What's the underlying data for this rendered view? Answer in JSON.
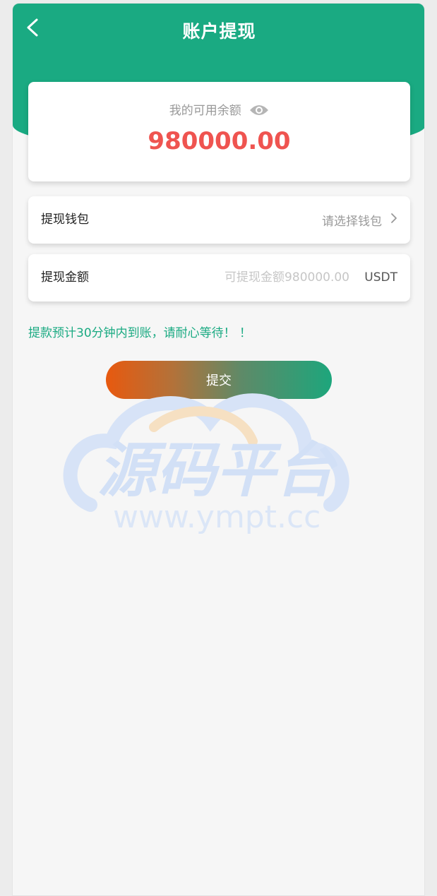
{
  "header": {
    "title": "账户提现",
    "back_icon": "chevron-left-icon",
    "color": "#1aaa82"
  },
  "balance": {
    "label": "我的可用余额",
    "eye_icon": "eye-icon",
    "amount": "980000.00",
    "amount_color": "#ef5450"
  },
  "wallet": {
    "label": "提现钱包",
    "select_placeholder": "请选择钱包",
    "chevron_icon": "chevron-right-icon"
  },
  "amount": {
    "label": "提现金额",
    "placeholder": "可提现金额980000.00",
    "unit": "USDT"
  },
  "notice": "提款预计30分钟内到账，请耐心等待！ ！",
  "submit_label": "提交",
  "watermark": {
    "text_cn": "源码平台",
    "text_url": "www.ympt.cc"
  }
}
